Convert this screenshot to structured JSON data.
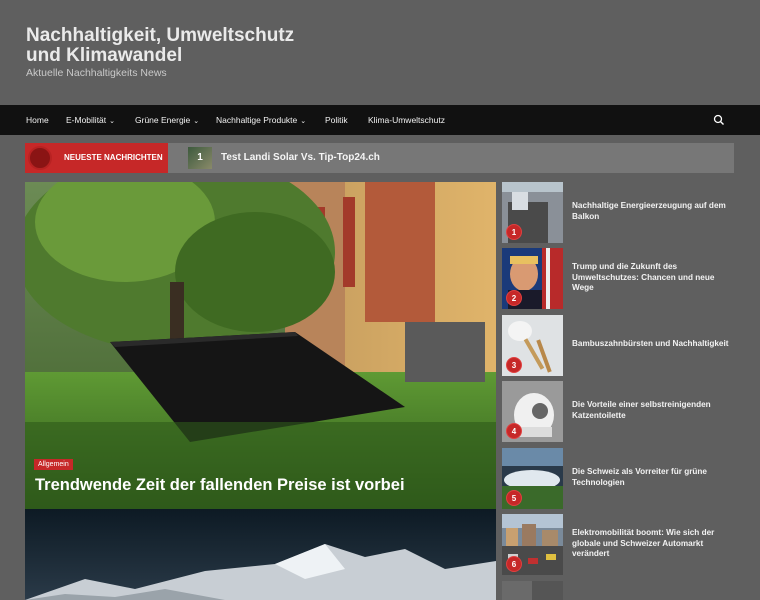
{
  "site": {
    "title": "Nachhaltigkeit, Umweltschutz und Klimawandel",
    "tagline": "Aktuelle Nachhaltigkeits News"
  },
  "nav": {
    "items": [
      {
        "label": "Home",
        "dropdown": false
      },
      {
        "label": "E-Mobilität",
        "dropdown": true
      },
      {
        "label": "Grüne Energie",
        "dropdown": true
      },
      {
        "label": "Nachhaltige Produkte",
        "dropdown": true
      },
      {
        "label": "Politik",
        "dropdown": false
      },
      {
        "label": "Klima-Umweltschutz",
        "dropdown": false
      }
    ],
    "caret": "⌄",
    "search_icon": "search-icon"
  },
  "ticker": {
    "label": "NEUESTE NACHRICHTEN",
    "item_number": "1",
    "item_title": "Test Landi Solar Vs. Tip-Top24.ch"
  },
  "hero": {
    "category": "Allgemein",
    "title": "Trendwende Zeit der fallenden Preise ist vorbei"
  },
  "sidebar": [
    {
      "num": "1",
      "title": "Nachhaltige Energieerzeugung auf dem Balkon"
    },
    {
      "num": "2",
      "title": "Trump und die Zukunft des Umweltschutzes: Chancen und neue Wege"
    },
    {
      "num": "3",
      "title": "Bambuszahnbürsten und Nachhaltigkeit"
    },
    {
      "num": "4",
      "title": "Die Vorteile einer selbstreinigenden Katzentoilette"
    },
    {
      "num": "5",
      "title": "Die Schweiz als Vorreiter für grüne Technologien"
    },
    {
      "num": "6",
      "title": "Elektromobilität boomt: Wie sich der globale und Schweizer Automarkt verändert"
    }
  ],
  "colors": {
    "accent": "#c62828",
    "nav_bg": "#111111",
    "page_bg": "#5f5f5f"
  }
}
